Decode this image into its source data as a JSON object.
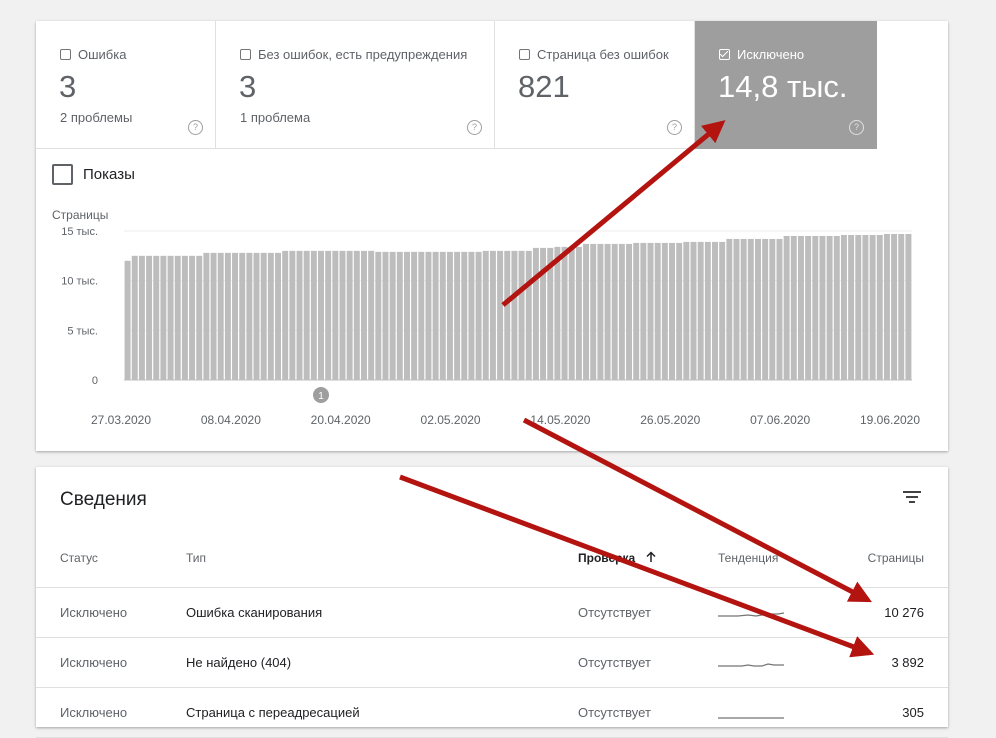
{
  "summary_tiles": [
    {
      "label": "Ошибка",
      "value": "3",
      "sub": "2 проблемы",
      "selected": false
    },
    {
      "label": "Без ошибок, есть предупреждения",
      "value": "3",
      "sub": "1 проблема",
      "selected": false
    },
    {
      "label": "Страница без ошибок",
      "value": "821",
      "sub": "",
      "selected": false
    },
    {
      "label": "Исключено",
      "value": "14,8 тыс.",
      "sub": "",
      "selected": true
    }
  ],
  "help_glyph": "?",
  "impressions_label": "Показы",
  "chart_data": {
    "type": "bar",
    "ylabel": "Страницы",
    "ylim": [
      0,
      15000
    ],
    "yticks": [
      {
        "value": 0,
        "label": "0"
      },
      {
        "value": 5000,
        "label": "5 тыс."
      },
      {
        "value": 10000,
        "label": "10 тыс."
      },
      {
        "value": 15000,
        "label": "15 тыс."
      }
    ],
    "xticks": [
      "27.03.2020",
      "08.04.2020",
      "20.04.2020",
      "02.05.2020",
      "14.05.2020",
      "26.05.2020",
      "07.06.2020",
      "19.06.2020"
    ],
    "bar_color": "#bdbdbd",
    "annotation": {
      "label": "1",
      "index": 27
    },
    "values": [
      12000,
      12500,
      12500,
      12500,
      12500,
      12500,
      12500,
      12500,
      12500,
      12500,
      12500,
      12800,
      12800,
      12800,
      12800,
      12800,
      12800,
      12800,
      12800,
      12800,
      12800,
      12800,
      13000,
      13000,
      13000,
      13000,
      13000,
      13000,
      13000,
      13000,
      13000,
      13000,
      13000,
      13000,
      13000,
      12900,
      12900,
      12900,
      12900,
      12900,
      12900,
      12900,
      12900,
      12900,
      12900,
      12900,
      12900,
      12900,
      12900,
      12900,
      13000,
      13000,
      13000,
      13000,
      13000,
      13000,
      13000,
      13300,
      13300,
      13300,
      13400,
      13400,
      13400,
      13400,
      13700,
      13700,
      13700,
      13700,
      13700,
      13700,
      13700,
      13800,
      13800,
      13800,
      13800,
      13800,
      13800,
      13800,
      13900,
      13900,
      13900,
      13900,
      13900,
      13900,
      14200,
      14200,
      14200,
      14200,
      14200,
      14200,
      14200,
      14200,
      14500,
      14500,
      14500,
      14500,
      14500,
      14500,
      14500,
      14500,
      14600,
      14600,
      14600,
      14600,
      14600,
      14600,
      14700,
      14700,
      14700,
      14700
    ]
  },
  "details": {
    "title": "Сведения",
    "columns": {
      "status": "Статус",
      "type": "Тип",
      "check": "Проверка",
      "trend": "Тенденция",
      "pages": "Страницы"
    },
    "rows": [
      {
        "status": "Исключено",
        "type": "Ошибка сканирования",
        "check": "Отсутствует",
        "pages": "10 276"
      },
      {
        "status": "Исключено",
        "type": "Не найдено (404)",
        "check": "Отсутствует",
        "pages": "3 892"
      },
      {
        "status": "Исключено",
        "type": "Страница с переадресацией",
        "check": "Отсутствует",
        "pages": "305"
      }
    ]
  },
  "colors": {
    "selected_tile": "#9e9e9e",
    "arrow": "#b3140f",
    "bar": "#bdbdbd"
  }
}
